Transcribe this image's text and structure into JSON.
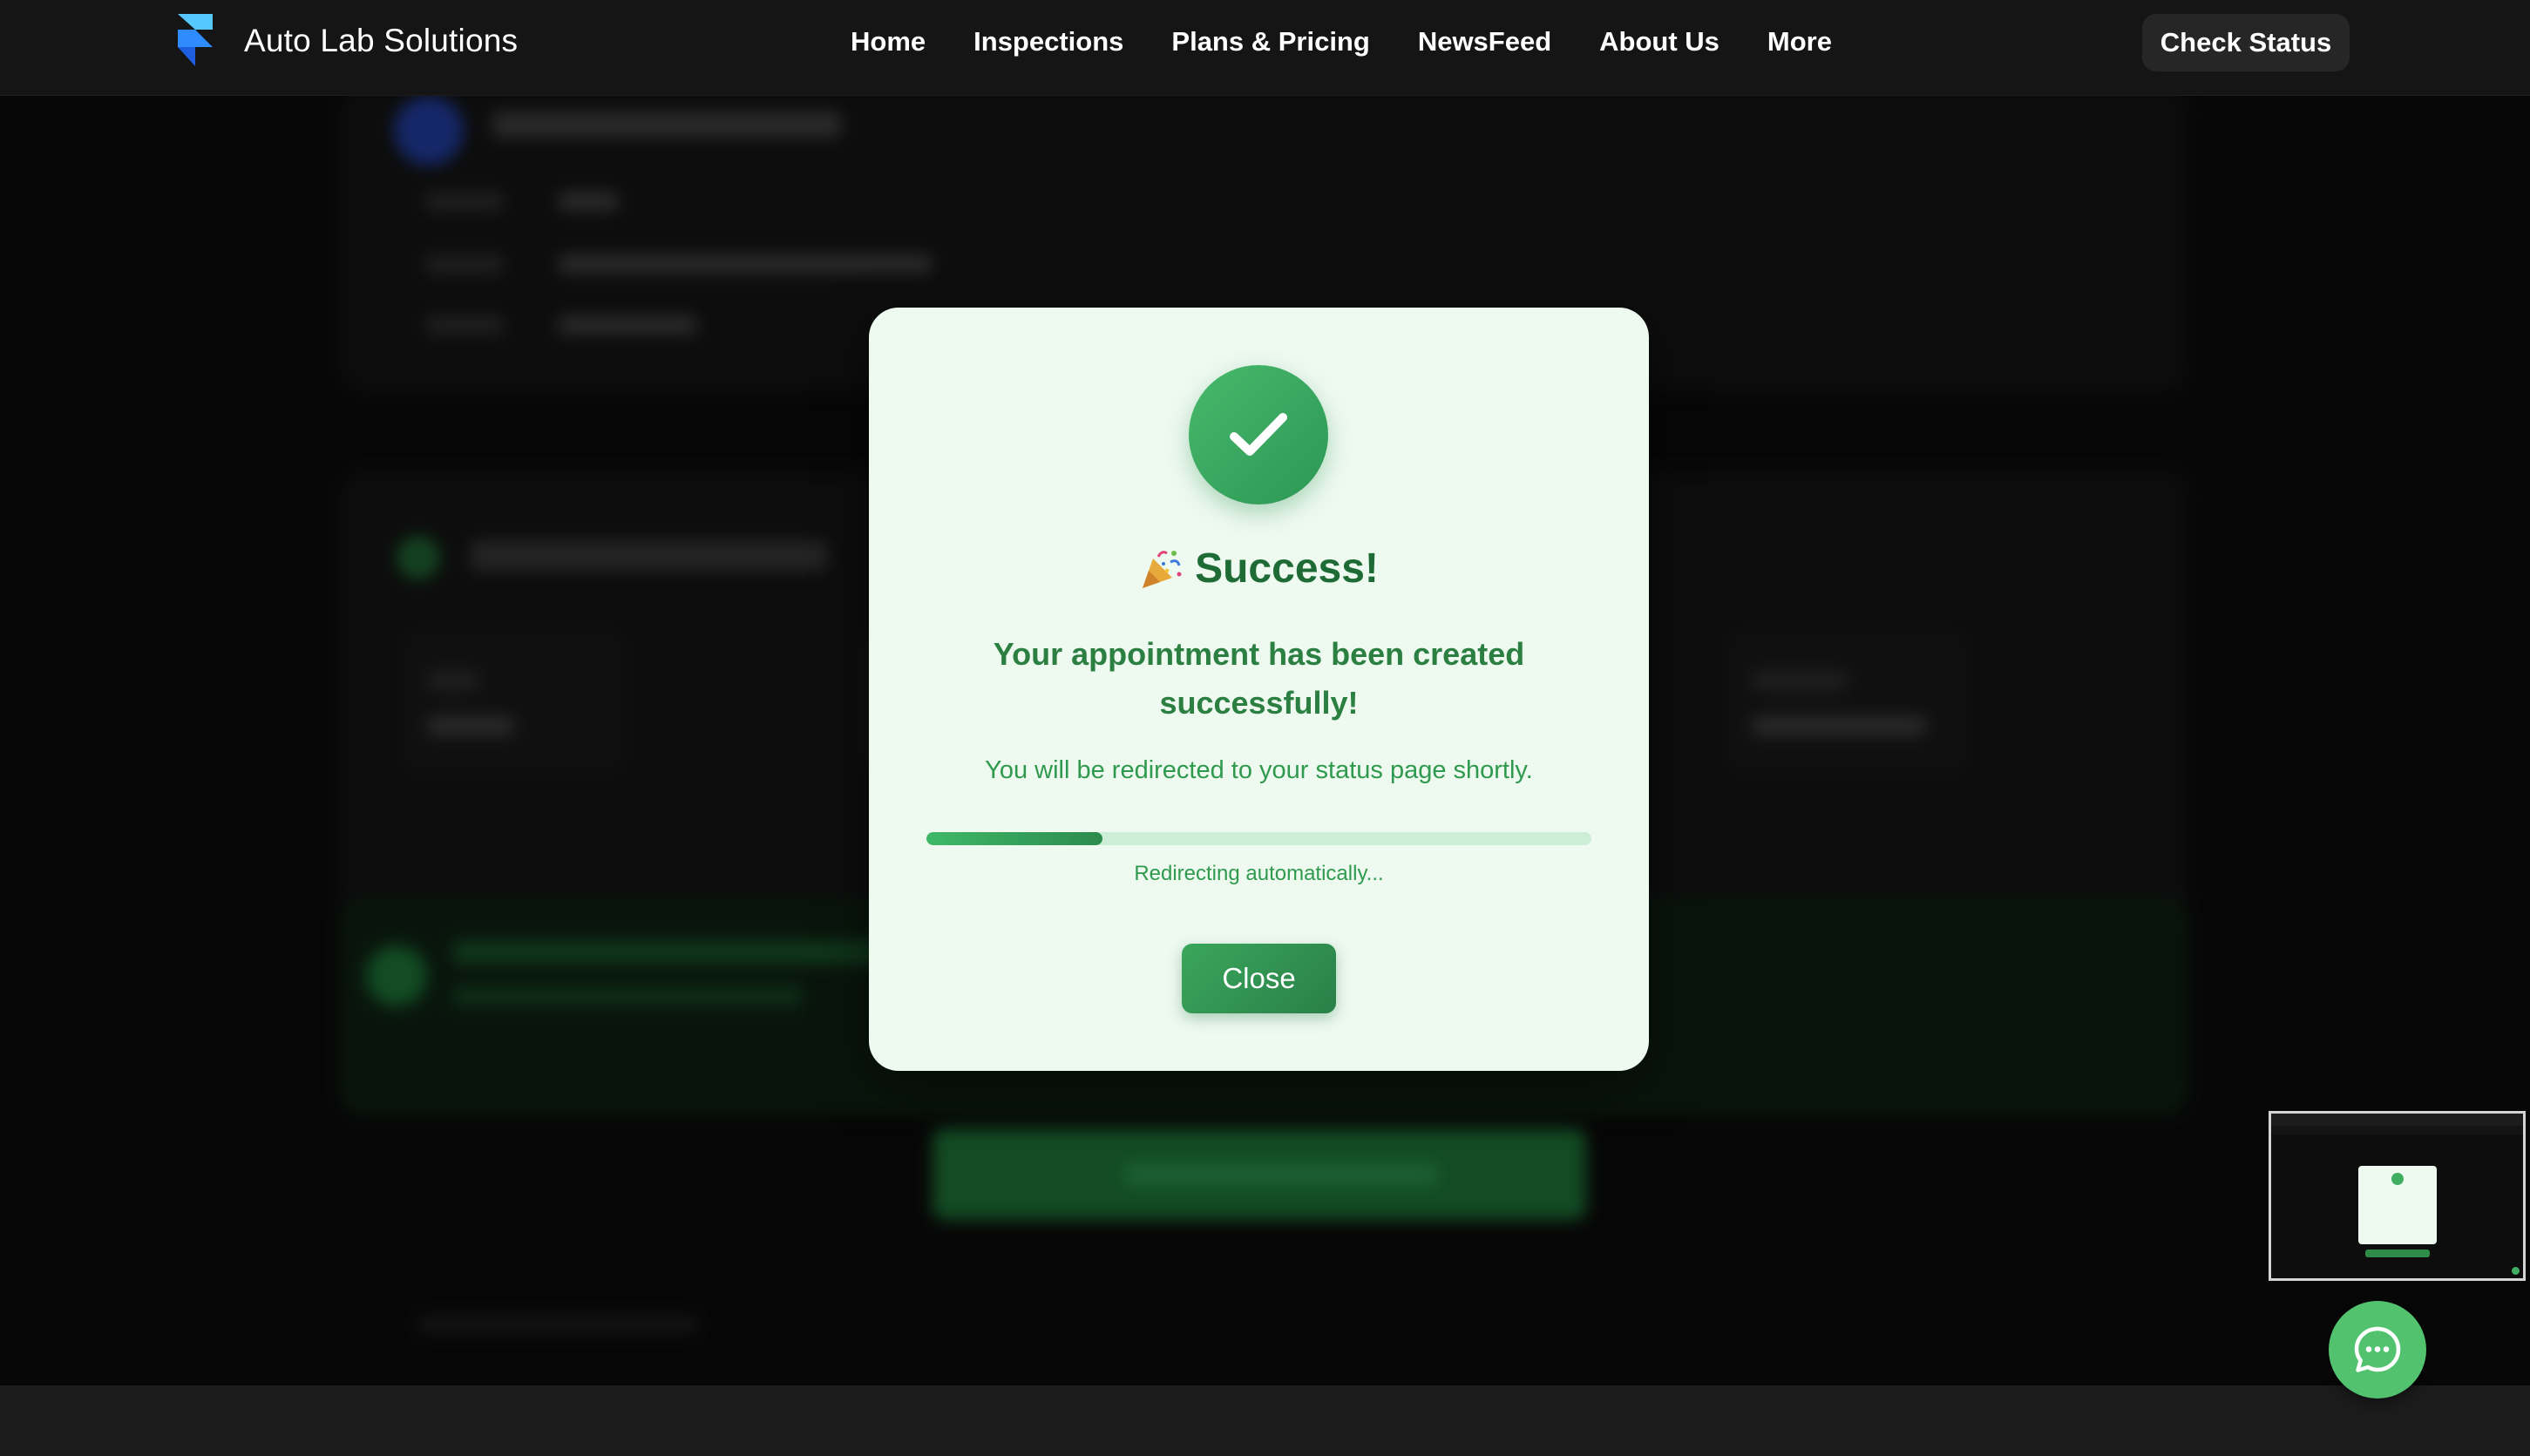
{
  "brand": {
    "name": "Auto Lab Solutions",
    "logo_icon": "framer-logo-icon",
    "logo_colors": [
      "#56c8ff",
      "#1e6df5"
    ]
  },
  "nav": {
    "items": [
      {
        "label": "Home"
      },
      {
        "label": "Inspections"
      },
      {
        "label": "Plans & Pricing"
      },
      {
        "label": "NewsFeed"
      },
      {
        "label": "About Us"
      },
      {
        "label": "More"
      }
    ],
    "cta_label": "Check Status"
  },
  "modal": {
    "icon": "check-icon",
    "title_emoji_icon": "party-popper-icon",
    "title": "Success!",
    "message": "Your appointment has been created successfully!",
    "sub_message": "You will be redirected to your status page shortly.",
    "progress_fraction": 0.265,
    "redirect_text": "Redirecting automatically...",
    "close_label": "Close"
  },
  "colors": {
    "accent_green": "#2e9a52",
    "title_green": "#1e6b35",
    "modal_bg": "#eef9f0",
    "page_bg": "#0c0c0c",
    "nav_bg": "#151515"
  },
  "chat": {
    "icon": "chat-bubble-icon"
  }
}
